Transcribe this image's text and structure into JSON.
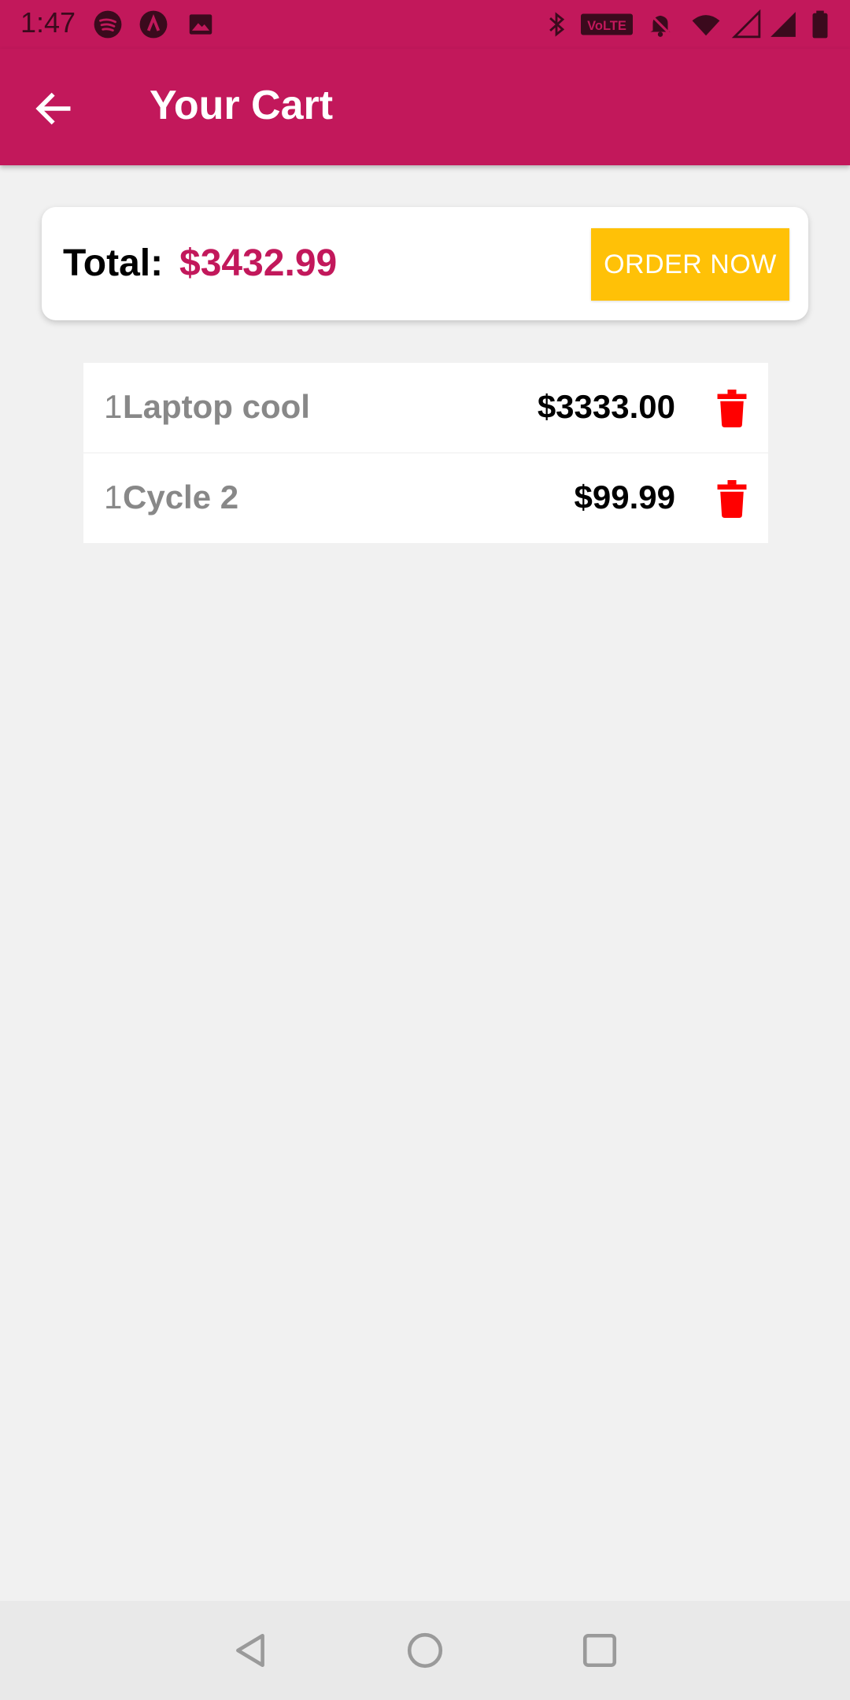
{
  "status_bar": {
    "time": "1:47",
    "left_icons": [
      "spotify-icon",
      "app-a-icon",
      "image-icon"
    ],
    "right_icons": [
      "bluetooth-icon",
      "volte-icon",
      "mute-bell-icon",
      "wifi-icon",
      "signal-icon",
      "signal-icon",
      "battery-icon"
    ],
    "volte_label": "VoLTE"
  },
  "app_bar": {
    "back_icon": "arrow-left-icon",
    "title": "Your Cart",
    "background": "#c2185b"
  },
  "summary": {
    "total_label": "Total:",
    "total_amount": "$3432.99",
    "amount_color": "#c2185b",
    "order_button": "ORDER NOW",
    "order_button_color": "#ffc107"
  },
  "cart": {
    "items": [
      {
        "quantity": "1",
        "name": "Laptop cool",
        "price": "$3333.00",
        "delete_icon": "trash-icon"
      },
      {
        "quantity": "1",
        "name": "Cycle 2",
        "price": "$99.99",
        "delete_icon": "trash-icon"
      }
    ],
    "delete_color": "#ff0000"
  },
  "nav_bar": {
    "icons": [
      "back-triangle-icon",
      "home-circle-icon",
      "recents-square-icon"
    ]
  }
}
